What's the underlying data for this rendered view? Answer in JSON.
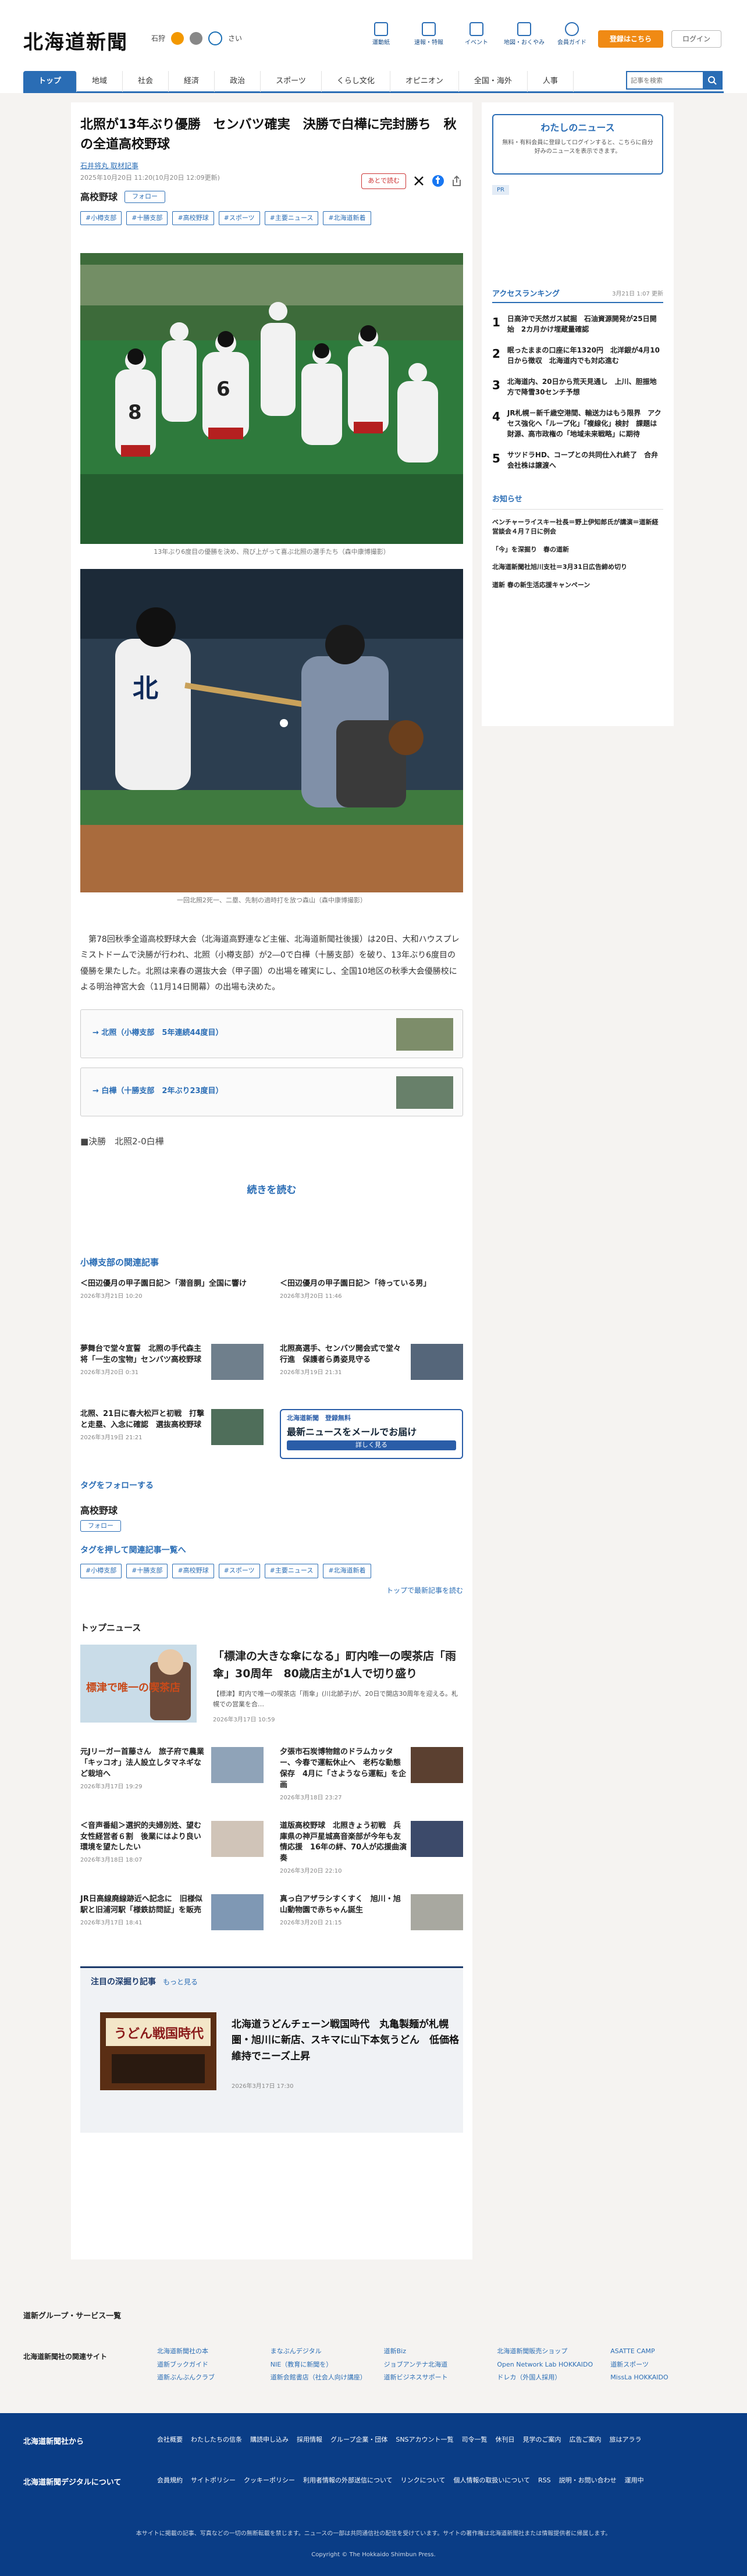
{
  "header": {
    "logo": "北海道新聞",
    "weather_area": "石狩",
    "weather_alt": "さい",
    "tools": [
      "運動紙",
      "速報・特報",
      "イベント",
      "地図・おくやみ",
      "会員ガイド"
    ],
    "register": "登録はこちら",
    "login": "ログイン"
  },
  "nav": {
    "tabs": [
      "トップ",
      "地域",
      "社会",
      "経済",
      "政治",
      "スポーツ",
      "くらし文化",
      "オピニオン",
      "全国・海外",
      "人事"
    ],
    "search_placeholder": "記事を検索"
  },
  "article": {
    "title": "北照が13年ぶり優勝　センバツ確実　決勝で白樺に完封勝ち　秋の全道高校野球",
    "author": "石井将丸",
    "author_suffix": "取材記事",
    "date": "2025年10月20日 11:20(10月20日 12:09更新)",
    "tag": "高校野球",
    "follow": "フォロー",
    "chips": [
      "#小樽支部",
      "#十勝支部",
      "#高校野球",
      "#スポーツ",
      "#主要ニュース",
      "#北海道新着"
    ],
    "later": "あとで読む",
    "photo1_caption": "13年ぶり6度目の優勝を決め、飛び上がって喜ぶ北照の選手たち（森中康博撮影）",
    "photo2_caption": "一回北照2死一、二塁、先制の適時打を放つ森山（森中康博撮影）",
    "body": "第78回秋季全道高校野球大会（北海道高野連など主催、北海道新聞社後援）は20日、大和ハウスプレミストドームで決勝が行われ、北照（小樽支部）が2―0で白樺（十勝支部）を破り、13年ぶり6度目の優勝を果たした。北照は来春の選抜大会（甲子園）の出場を確実にし、全国10地区の秋季大会優勝校による明治神宮大会（11月14日開幕）の出場も決めた。",
    "links": [
      "→ 北照（小樽支部　5年連続44度目）",
      "→ 白樺（十勝支部　2年ぶり23度目）"
    ],
    "result": "■決勝　北照2-0白樺",
    "read_more": "続きを読む"
  },
  "related": {
    "heading": "小樽支部の関連記事",
    "items": [
      {
        "title": "＜田辺優月の甲子園日記＞「潜音胴」全国に響け",
        "date": "2026年3月21日 10:20"
      },
      {
        "title": "＜田辺優月の甲子園日記＞「待っている男」",
        "date": "2026年3月20日 11:46"
      },
      {
        "title": "夢舞台で堂々宣誓　北照の手代森主将「一生の宝物」センバツ高校野球",
        "date": "2026年3月20日 0:31"
      },
      {
        "title": "北照高選手、センバツ開会式で堂々行進　保護者ら勇姿見守る",
        "date": "2026年3月19日 21:31"
      },
      {
        "title": "北照、21日に春大松戸と初戦　打撃と走塁、入念に確認　選抜高校野球",
        "date": "2026年3月19日 21:21"
      }
    ],
    "mail": {
      "head": "北海道新聞　登録無料",
      "main": "最新ニュースをメールでお届け",
      "btn": "詳しく見る"
    }
  },
  "tagfollow": {
    "heading": "タグをフォローする",
    "name": "高校野球",
    "follow": "フォロー",
    "list_heading": "タグを押して関連記事一覧へ",
    "chips": [
      "#小樽支部",
      "#十勝支部",
      "#高校野球",
      "#スポーツ",
      "#主要ニュース",
      "#北海道新着"
    ],
    "to_top": "トップで最新記事を読む"
  },
  "topnews": {
    "heading": "トップニュース",
    "feature": {
      "title": "「標津の大きな傘になる」町内唯一の喫茶店「雨傘」30周年　80歳店主が1人で切り盛り",
      "body": "【標津】町内で唯一の喫茶店「雨傘」(川北節子)が、20日で開店30周年を迎える。札幌での営業を合…",
      "date": "2026年3月17日 10:59",
      "image_text": "標津で唯一の喫茶店"
    },
    "items": [
      {
        "title": "元Jリーガー首藤さん　旅子府で農業「キッコオ」法人設立しタマネギなど栽培へ",
        "date": "2026年3月17日 19:29"
      },
      {
        "title": "夕張市石炭博物館のドラムカッター、今春で運転休止へ　老朽な動態保存　4月に「さようなら運転」を企画",
        "date": "2026年3月18日 23:27"
      },
      {
        "title": "＜音声番組＞選択的夫婦別姓、望む女性経営者６割　後業にはより良い環境を望たしたい",
        "date": "2026年3月18日 18:07"
      },
      {
        "title": "道版高校野球　北照きょう初戦　兵庫県の神戸星城高音楽部が今年も友情応援　16年の絆、70人が応援曲演奏",
        "date": "2026年3月20日 22:10"
      },
      {
        "title": "JR日高線廃線跡近へ記念に　旧様似駅と旧浦河駅「様鉄訪問証」を販売",
        "date": "2026年3月17日 18:41"
      },
      {
        "title": "真っ白アザラシすくすく　旭川・旭山動物園で赤ちゃん誕生",
        "date": "2026年3月20日 21:15"
      }
    ]
  },
  "deep": {
    "heading": "注目の深掘り記事",
    "more": "もっと見る",
    "title": "北海道うどんチェーン戦国時代　丸亀製麺が札幌圏・旭川に新店、スキマに山下本気うどん　低価格維持でニーズ上昇",
    "date": "2026年3月17日 17:30",
    "image_text": "うどん戦国時代"
  },
  "sidebar": {
    "mynews_title": "わたしのニュース",
    "mynews_text": "無料・有料会員に登録してログインすると、こちらに自分好みのニュースを表示できます。",
    "pr": "PR",
    "ranking_title": "アクセスランキング",
    "ranking_updated": "3月21日 1:07 更新",
    "ranking": [
      {
        "no": "1",
        "title": "日高沖で天然ガス試掘　石油資源開発が25日開始　2カ月かけ埋蔵量確認"
      },
      {
        "no": "2",
        "title": "眠ったままの口座に年1320円　北洋銀が4月10日から徴収　北海道内でも対応進む"
      },
      {
        "no": "3",
        "title": "北海道内、20日から荒天見通し　上川、胆振地方で降雪30センチ予想"
      },
      {
        "no": "4",
        "title": "JR札幌－新千歳空港間、輸送力はもう限界　アクセス強化へ「ループ化」「複線化」検討　課題は財源、高市政権の「地域未来戦略」に期待"
      },
      {
        "no": "5",
        "title": "サツドラHD、コープとの共同仕入れ終了　合弁会社株は譲渡へ"
      }
    ],
    "notice_title": "お知らせ",
    "notices": [
      "ベンチャーライスキー社長＝野上伊知郎氏が講演＝道新経営談会４月７日に例会",
      "「今」を深掘り　春の道新",
      "北海道新聞社旭川支社＝3月31日広告締め切り",
      "道新 春の新生活応援キャンペーン"
    ]
  },
  "group": {
    "title": "道新グループ・サービス一覧",
    "label": "北海道新聞社の関連サイト",
    "links": [
      "北海道新聞社の本",
      "まなぶんデジタル",
      "道新Biz",
      "北海道新聞販売ショップ",
      "ASATTE CAMP",
      "道新ブックガイド",
      "NIE（教育に新聞を）",
      "ジョブアンテナ北海道",
      "Open Network Lab HOKKAIDO",
      "道新スポーツ",
      "道新ぶんぶんクラブ",
      "道新会館書店（社会人向け講座）",
      "道新ビジネスサポート",
      "ドレカ（外国人採用）",
      "MissLa HOKKAIDO"
    ]
  },
  "footer": {
    "row1_label": "北海道新聞社から",
    "row1_links": [
      "会社概要",
      "わたしたちの信条",
      "購読申し込み",
      "採用情報",
      "グループ企業・団体",
      "SNSアカウント一覧",
      "司令一覧",
      "休刊日",
      "見学のご案内",
      "広告ご案内",
      "旅はアララ"
    ],
    "row2_label": "北海道新聞デジタルについて",
    "row2_links": [
      "会員規約",
      "サイトポリシー",
      "クッキーポリシー",
      "利用者情報の外部送信について",
      "リンクについて",
      "個人情報の取扱いについて",
      "RSS",
      "説明・お問い合わせ",
      "運用中"
    ],
    "note": "本サイトに掲載の記事、写真などの一切の無断転載を禁じます。ニュースの一部は共同通信社の配信を受けています。サイトの著作権は北海道新聞社または情報提供者に帰属します。",
    "copyright": "Copyright © The Hokkaido Shimbun Press."
  },
  "colors": {
    "accent": "#2a6db5",
    "register": "#f08a14",
    "footer": "#0a3d86"
  }
}
